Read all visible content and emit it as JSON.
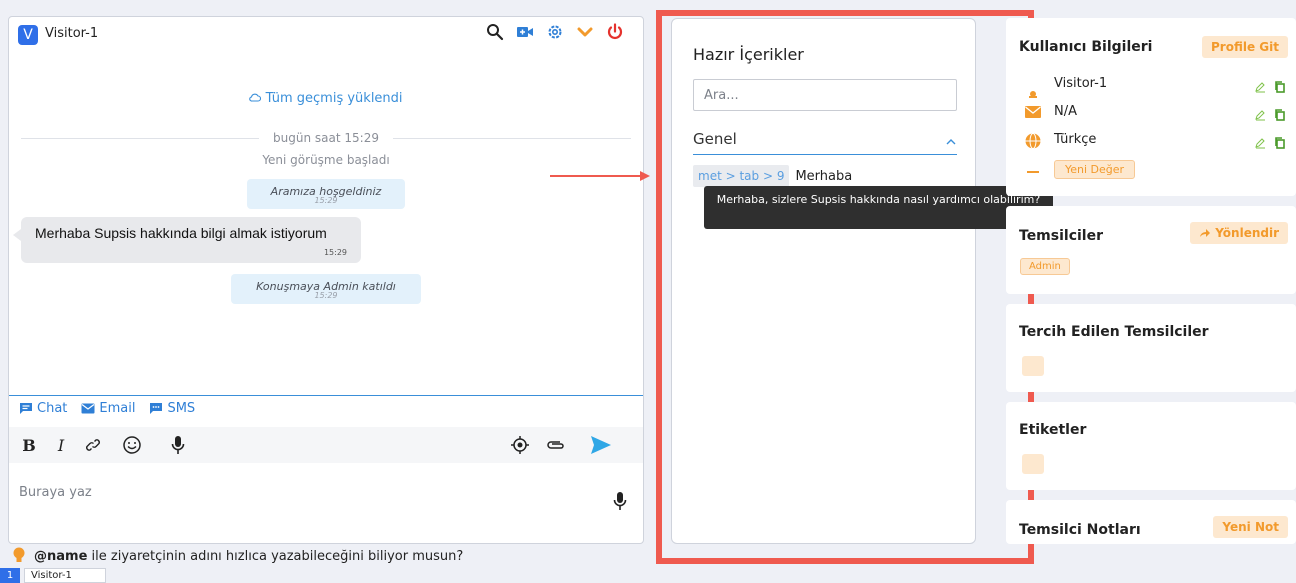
{
  "chat": {
    "badge": "V",
    "visitor": "Visitor-1",
    "history_loaded": "Tüm geçmiş yüklendi",
    "date": "bugün saat 15:29",
    "new_conversation": "Yeni görüşme başladı",
    "messages": [
      {
        "type": "system",
        "text": "Aramıza hoşgeldiniz",
        "time": "15:29"
      },
      {
        "type": "visitor",
        "text": "Merhaba Supsis hakkında bilgi almak istiyorum",
        "time": "15:29"
      },
      {
        "type": "system",
        "text": "Konuşmaya Admin katıldı",
        "time": "15:29"
      }
    ],
    "tabs": {
      "chat": "Chat",
      "email": "Email",
      "sms": "SMS"
    },
    "composer_placeholder": "Buraya yaz"
  },
  "canned": {
    "title": "Hazır İçerikler",
    "search_placeholder": "Ara...",
    "category": "Genel",
    "shortcut": "met > tab > 9",
    "item_text": "Merhaba",
    "tooltip": "Merhaba, sizlere Supsis hakkında nasıl yardımcı olabilirim?"
  },
  "user_info": {
    "title": "Kullanıcı Bilgileri",
    "button": "Profile Git",
    "name": "Visitor-1",
    "email": "N/A",
    "language": "Türkçe",
    "new_value": "Yeni Değer"
  },
  "agents": {
    "title": "Temsilciler",
    "button": "Yönlendir",
    "tag": "Admin"
  },
  "preferred_agents": {
    "title": "Tercih Edilen Temsilciler"
  },
  "labels": {
    "title": "Etiketler"
  },
  "agent_notes": {
    "title": "Temsilci Notları",
    "button": "Yeni Not"
  },
  "tip": {
    "highlight": "@name",
    "text": " ile ziyaretçinin adını hızlıca yazabileceğini biliyor musun?"
  },
  "bottom_bar": {
    "badge": "1",
    "visitor": "Visitor-1"
  },
  "colors": {
    "accent_blue": "#2f7fd6",
    "orange": "#f29a2c",
    "highlight_red": "#ef5a4f",
    "power_red": "#e5322d"
  }
}
